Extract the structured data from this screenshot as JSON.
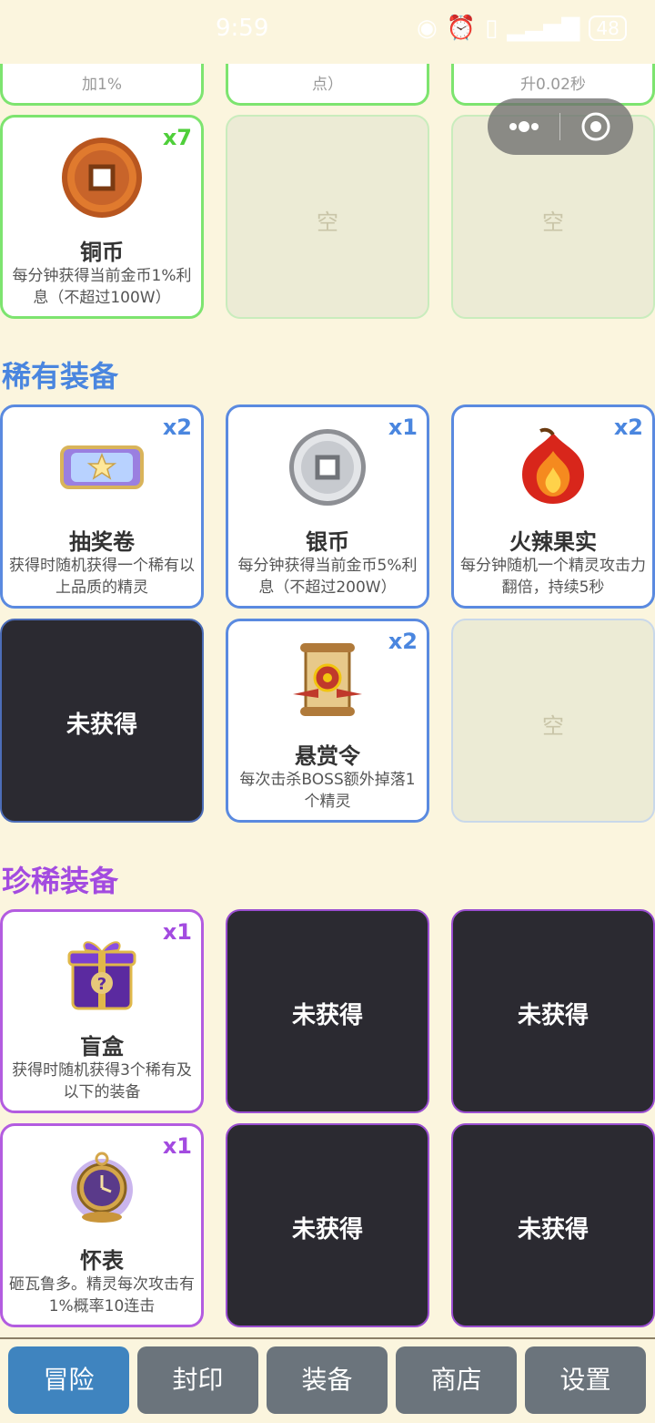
{
  "status_bar": {
    "time": "9:59",
    "battery": "48"
  },
  "top_partial": [
    "加1%",
    "点）",
    "升0.02秒"
  ],
  "common_row": {
    "item": {
      "name": "铜币",
      "qty": "x7",
      "desc": "每分钟获得当前金币1%利息（不超过100W）"
    },
    "empty_label": "空"
  },
  "rare": {
    "title": "稀有装备",
    "items": [
      {
        "name": "抽奖卷",
        "qty": "x2",
        "desc": "获得时随机获得一个稀有以上品质的精灵"
      },
      {
        "name": "银币",
        "qty": "x1",
        "desc": "每分钟获得当前金币5%利息（不超过200W）"
      },
      {
        "name": "火辣果实",
        "qty": "x2",
        "desc": "每分钟随机一个精灵攻击力翻倍，持续5秒"
      },
      {
        "name": "悬赏令",
        "qty": "x2",
        "desc": "每次击杀BOSS额外掉落1个精灵"
      }
    ]
  },
  "epic": {
    "title": "珍稀装备",
    "items": [
      {
        "name": "盲盒",
        "qty": "x1",
        "desc": "获得时随机获得3个稀有及以下的装备"
      },
      {
        "name": "怀表",
        "qty": "x1",
        "desc": "砸瓦鲁多。精灵每次攻击有1%概率10连击"
      }
    ]
  },
  "locked_label": "未获得",
  "empty_label": "空",
  "tabs": [
    "冒险",
    "封印",
    "装备",
    "商店",
    "设置"
  ],
  "colors": {
    "common": "#7de46f",
    "rare": "#5a8ae0",
    "epic": "#b35ce0",
    "active_tab": "#3f84bf",
    "tab": "#6b747c"
  }
}
